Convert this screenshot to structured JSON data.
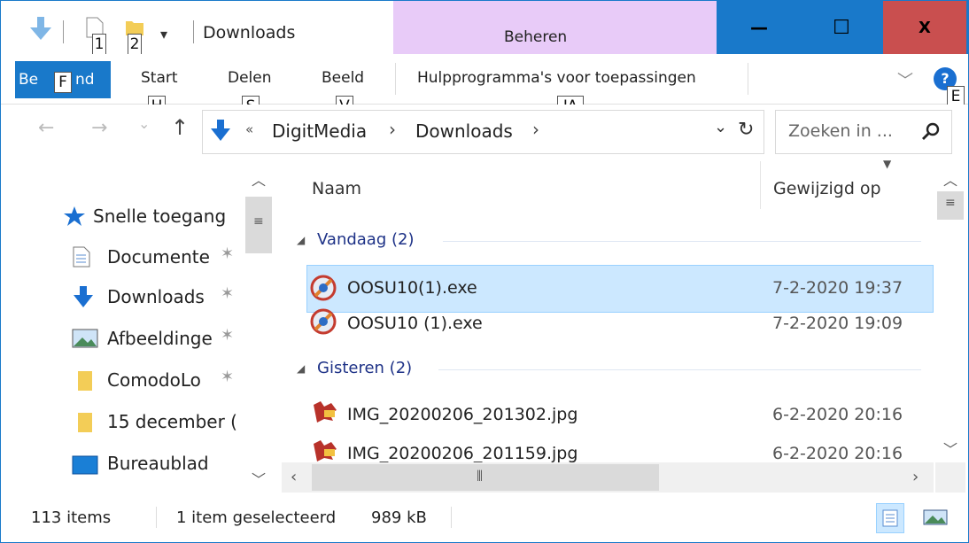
{
  "window": {
    "title": "Downloads",
    "context_tab": "Beheren",
    "minimize_glyph": "—",
    "maximize_glyph": "☐",
    "close_glyph": "X"
  },
  "quick_access": {
    "keytip_1": "1",
    "keytip_2": "2",
    "dropdown_glyph": "▾"
  },
  "ribbon": {
    "file_tab": "Be",
    "file_tab_tail": "nd",
    "file_keytip": "F",
    "tabs": [
      {
        "label": "Start",
        "keytip": "H"
      },
      {
        "label": "Delen",
        "keytip": "S"
      },
      {
        "label": "Beeld",
        "keytip": "V"
      },
      {
        "label": "Hulpprogramma's voor toepassingen",
        "keytip": "JA"
      }
    ],
    "help_keytip": "E",
    "expand_glyph": "﹀",
    "help_glyph": "?"
  },
  "navigation": {
    "back_glyph": "←",
    "forward_glyph": "→",
    "recent_glyph": "⌄",
    "up_glyph": "↑",
    "overflow": "«",
    "breadcrumb": [
      "DigitMedia",
      "Downloads"
    ],
    "sep": "›",
    "dropdown_glyph": "⌄",
    "refresh_glyph": "↻",
    "search_placeholder": "Zoeken in ...",
    "search_glyph": "⚲"
  },
  "sidebar": {
    "items": [
      {
        "label": "Snelle toegang",
        "icon": "star-icon"
      },
      {
        "label": "Documente",
        "icon": "document-icon",
        "pinned": true
      },
      {
        "label": "Downloads",
        "icon": "download-icon",
        "pinned": true
      },
      {
        "label": "Afbeeldinge",
        "icon": "pictures-icon",
        "pinned": true
      },
      {
        "label": "ComodoLo",
        "icon": "folder-icon",
        "pinned": true
      },
      {
        "label": "15 december (",
        "icon": "folder-icon"
      },
      {
        "label": "Bureaublad",
        "icon": "desktop-icon"
      }
    ]
  },
  "file_list": {
    "columns": {
      "name": "Naam",
      "modified": "Gewijzigd op"
    },
    "groups": [
      {
        "label": "Vandaag (2)",
        "files": [
          {
            "name": "OOSU10(1).exe",
            "modified": "7-2-2020 19:37",
            "selected": true
          },
          {
            "name": "OOSU10 (1).exe",
            "modified": "7-2-2020 19:09",
            "selected": false
          }
        ]
      },
      {
        "label": "Gisteren (2)",
        "files": [
          {
            "name": "IMG_20200206_201302.jpg",
            "modified": "6-2-2020 20:16",
            "selected": false
          },
          {
            "name": "IMG_20200206_201159.jpg",
            "modified": "6-2-2020 20:16",
            "selected": false
          }
        ]
      }
    ]
  },
  "status_bar": {
    "count": "113 items",
    "selection": "1 item geselecteerd",
    "size": "989 kB"
  },
  "colors": {
    "accent": "#1979ca",
    "context_tab": "#e8cbf8",
    "close": "#c94f4f",
    "selection": "#cce8ff",
    "group_header": "#1e3287"
  }
}
